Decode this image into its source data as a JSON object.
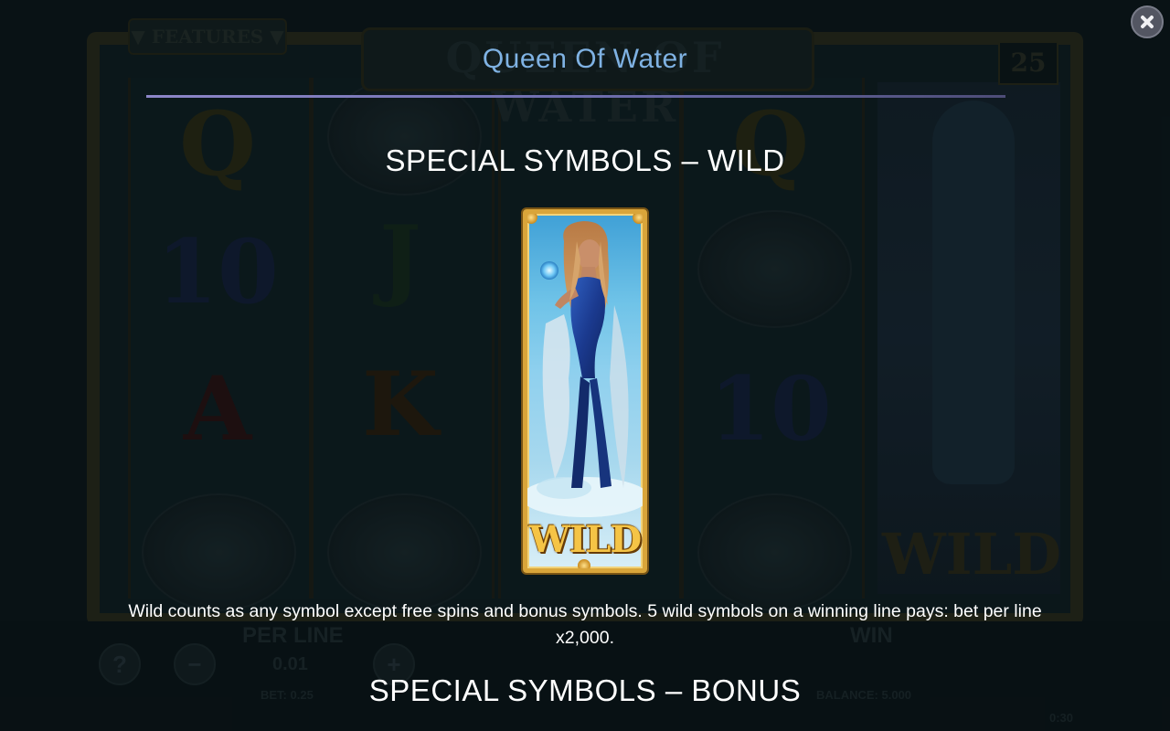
{
  "game": {
    "title": "Queen Of Water",
    "background": {
      "features_label": "▼ FEATURES ▼",
      "logo_text": "QUEEN OF WATER",
      "lines_count": "25",
      "reel_symbols": {
        "reel1": [
          "Q",
          "10",
          "A"
        ],
        "reel2": [
          "J",
          "K"
        ],
        "reel3": [],
        "reel4": [
          "Q",
          "10"
        ],
        "reel5": [
          "WILD"
        ]
      },
      "hud": {
        "per_line_label": "PER LINE",
        "per_line_value": "0.01",
        "bet_label": "BET: 0.25",
        "win_label": "WIN",
        "balance_label": "BALANCE: 5.000",
        "question_label": "?",
        "minus_label": "−",
        "plus_label": "+",
        "time_text": "0:30"
      }
    }
  },
  "help": {
    "close_icon": "close-icon",
    "sections": [
      {
        "heading": "SPECIAL SYMBOLS – WILD",
        "symbol_label": "WILD",
        "description": "Wild counts as any symbol except free spins and bonus symbols. 5 wild symbols on a winning line pays: bet per line x2,000."
      },
      {
        "heading": "SPECIAL SYMBOLS – BONUS"
      }
    ]
  },
  "colors": {
    "title": "#7fb2e3",
    "heading": "#ffffff",
    "wild_gold": "#f5c446",
    "frame_gold": "#d9a53a"
  }
}
